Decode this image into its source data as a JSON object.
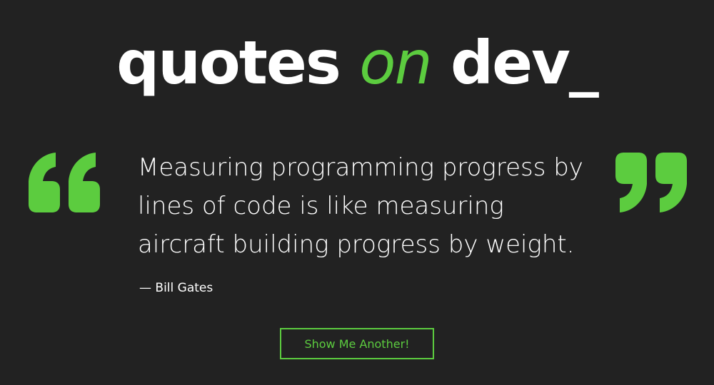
{
  "header": {
    "logo_part1": "quotes ",
    "logo_accent": "on",
    "logo_part2": " dev_"
  },
  "quote": {
    "text": "Measuring programming progress by lines of code is like measuring aircraft building progress by weight.",
    "author": "— Bill Gates"
  },
  "actions": {
    "next_label": "Show Me Another!"
  },
  "colors": {
    "background": "#222222",
    "accent": "#5ccc3f",
    "text": "#ffffff"
  },
  "icons": {
    "open_quote": "open-quote-icon",
    "close_quote": "close-quote-icon"
  }
}
